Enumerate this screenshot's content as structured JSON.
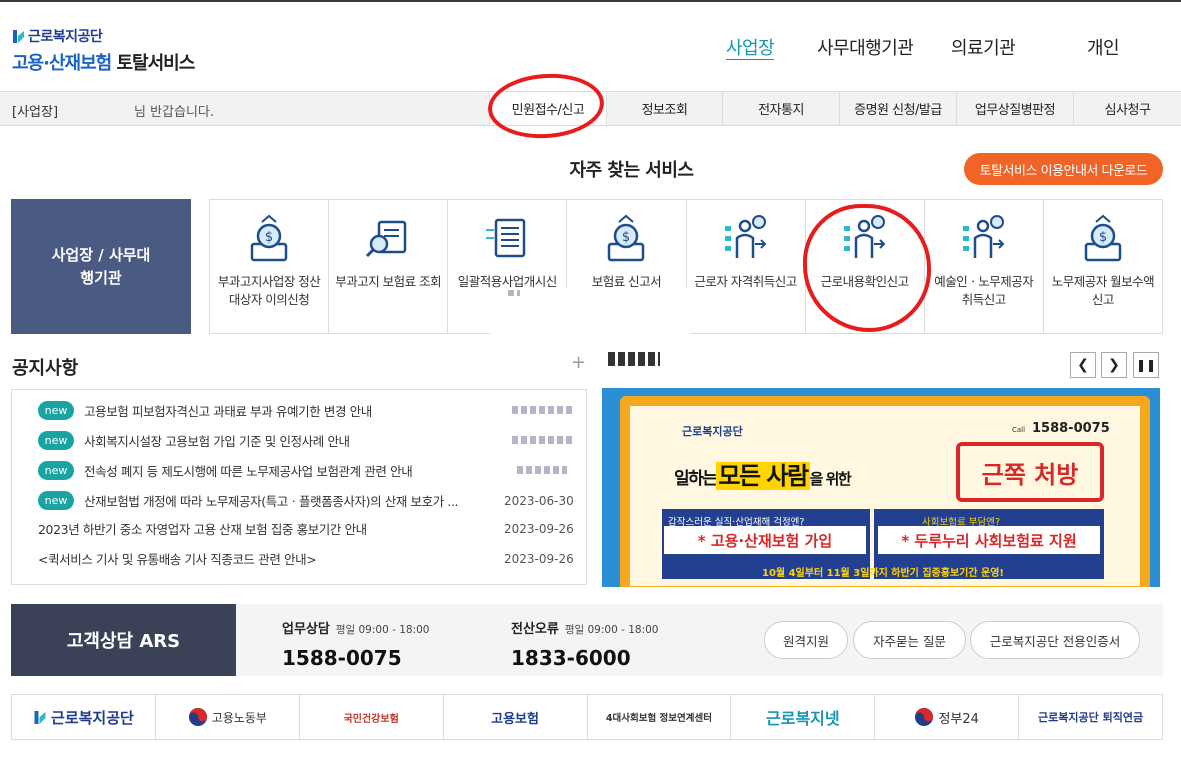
{
  "logo": {
    "org": "근로복지공단",
    "service_a": "고용·산재보험",
    "service_b": "토탈서비스"
  },
  "main_nav": [
    "사업장",
    "사무대행기관",
    "의료기관",
    "개인"
  ],
  "subbar": {
    "role": "[사업장]",
    "greeting": "님 반갑습니다.",
    "menus": [
      "민원접수/신고",
      "정보조회",
      "전자통지",
      "증명원 신청/발급",
      "업무상질병판정",
      "심사청구"
    ]
  },
  "frequent": {
    "title": "자주 찾는 서비스",
    "download": "토탈서비스 이용안내서 다운로드",
    "category": "사업장 / 사무대행기관",
    "services": [
      "부과고지사업장 정산대상자 이의신청",
      "부과고지 보험료 조회",
      "일괄적용사업개시신고",
      "보험료 신고서",
      "근로자 자격취득신고",
      "근로내용확인신고",
      "예술인ㆍ노무제공자 취득신고",
      "노무제공자 월보수액 신고"
    ]
  },
  "notice": {
    "title": "공지사항",
    "items": [
      {
        "new": "new",
        "text": "고용보험 피보험자격신고 과태료 부과 유예기한 변경 안내",
        "date": ""
      },
      {
        "new": "new",
        "text": "사회복지시설장 고용보험 가입 기준 및 인정사례 안내",
        "date": ""
      },
      {
        "new": "new",
        "text": "전속성 폐지 등 제도시행에 따른 노무제공사업 보험관계 관련 안내",
        "date": ""
      },
      {
        "new": "new",
        "text": "산재보험법 개정에 따라 노무제공자(특고ㆍ플랫폼종사자)의 산재 보호가 ...",
        "date": "2023-06-30"
      },
      {
        "new": "",
        "text": "2023년 하반기 중소 자영업자 고용 산재 보험 집중 홍보기간 안내",
        "date": "2023-09-26"
      },
      {
        "new": "",
        "text": "<퀵서비스 기사 및 유통배송 기사 직종코드 관련 안내>",
        "date": "2023-09-26"
      }
    ]
  },
  "banner": {
    "org": "근로복지공단",
    "call": "Call",
    "phone": "1588-0075",
    "headline_a": "일하는",
    "headline_b": "모든 사람",
    "headline_c": "을 위한",
    "stamp": "근쪽 처방",
    "q1": "갑작스러운 실직·산업재해 걱정엔?",
    "q2": "사회보험료 부담엔?",
    "a1": "* 고용·산재보험 가입",
    "a2": "* 두루누리 사회보험료 지원",
    "period": "10월 4일부터 11월 3일까지 하반기 집중홍보기간 운영!"
  },
  "contact": {
    "title": "고객상담 ARS",
    "biz_label": "업무상담",
    "biz_hours": "평일 09:00 - 18:00",
    "biz_phone": "1588-0075",
    "err_label": "전산오류",
    "err_hours": "평일 09:00 - 18:00",
    "err_phone": "1833-6000",
    "pills": [
      "원격지원",
      "자주묻는 질문",
      "근로복지공단 전용인증서"
    ]
  },
  "footer_logos": [
    "근로복지공단",
    "고용노동부",
    "국민건강보험",
    "고용보험",
    "4대사회보험 정보연계센터",
    "근로복지넷",
    "정부24",
    "근로복지공단 퇴직연금"
  ],
  "colors": {
    "accent": "#1696b3",
    "orange": "#f06428",
    "navy": "#4a5a82",
    "teal": "#1aa3a3",
    "annotation": "#e81c1c"
  }
}
